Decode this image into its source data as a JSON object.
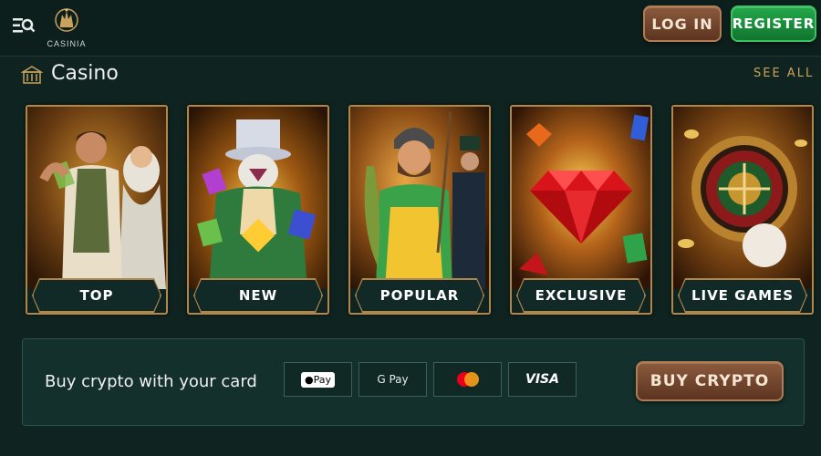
{
  "header": {
    "logo_text": "CASINIA",
    "login_label": "LOG IN",
    "register_label": "REGISTER"
  },
  "section": {
    "title": "Casino",
    "see_all_label": "SEE ALL"
  },
  "categories": [
    {
      "label": "TOP",
      "icon": "explorer-character"
    },
    {
      "label": "NEW",
      "icon": "wizard-character"
    },
    {
      "label": "POPULAR",
      "icon": "fisherman-character"
    },
    {
      "label": "EXCLUSIVE",
      "icon": "red-diamond"
    },
    {
      "label": "LIVE GAMES",
      "icon": "roulette-wheel"
    }
  ],
  "crypto_banner": {
    "text": "Buy crypto with your card",
    "payment_methods": [
      "Pay",
      "G Pay",
      "",
      "VISA"
    ],
    "button_label": "BUY CRYPTO"
  },
  "colors": {
    "background": "#0f2421",
    "accent_gold": "#c9a25c",
    "register_green": "#1a9440",
    "login_brown": "#6e4229"
  }
}
